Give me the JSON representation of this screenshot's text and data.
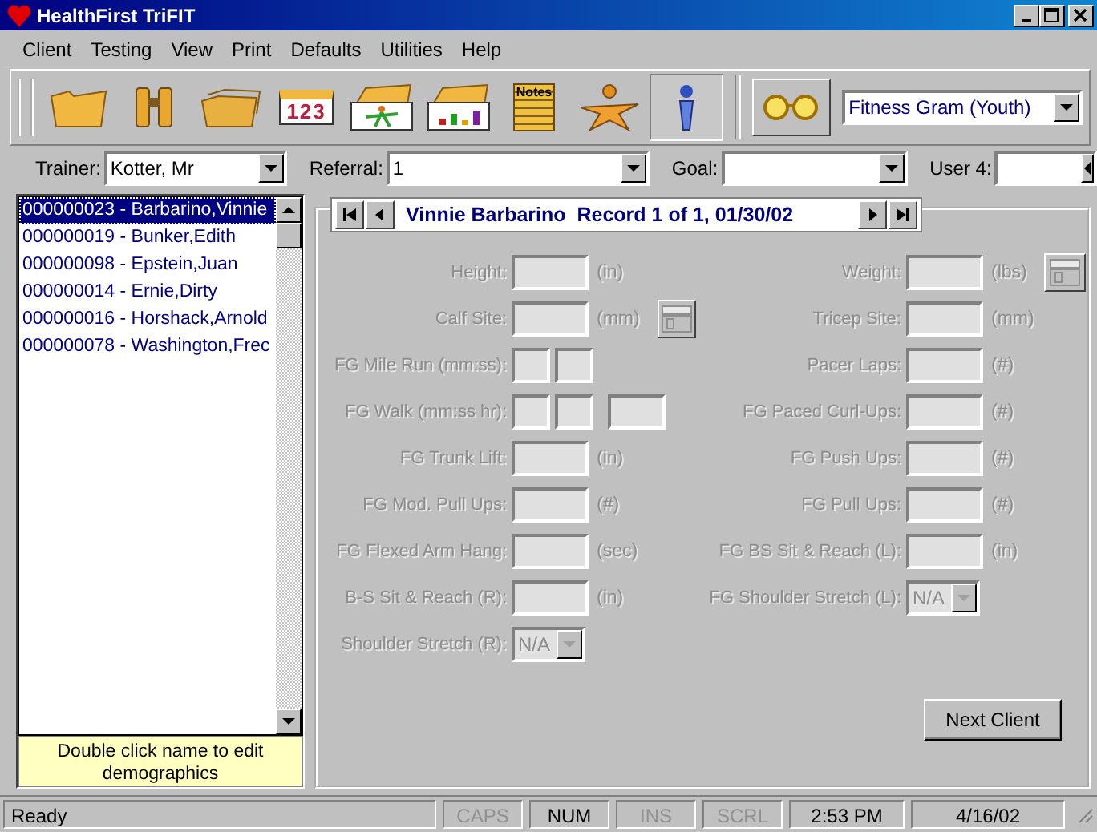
{
  "window": {
    "title": "HealthFirst TriFIT"
  },
  "menu": [
    "Client",
    "Testing",
    "View",
    "Print",
    "Defaults",
    "Utilities",
    "Help"
  ],
  "toolbar": [
    {
      "kind": "folder",
      "selected": false
    },
    {
      "kind": "binoculars",
      "selected": false
    },
    {
      "kind": "folders",
      "selected": false
    },
    {
      "kind": "numbers",
      "label": "123",
      "selected": false
    },
    {
      "kind": "figure-card",
      "selected": false
    },
    {
      "kind": "bar-card",
      "selected": false
    },
    {
      "kind": "notes",
      "label": "Notes",
      "selected": false
    },
    {
      "kind": "star-figure",
      "selected": false
    },
    {
      "kind": "info-figure",
      "selected": true
    },
    {
      "kind": "glasses",
      "selected": false
    }
  ],
  "test_selector": {
    "value": "Fitness Gram (Youth)"
  },
  "filters": [
    {
      "label": "Trainer:",
      "value": "Kotter, Mr"
    },
    {
      "label": "Referral:",
      "value": "1"
    },
    {
      "label": "Goal:"
    },
    {
      "label": "User 4:",
      "kind": "spin"
    }
  ],
  "clients": [
    {
      "text": "000000023 - Barbarino,Vinnie",
      "selected": true
    },
    {
      "text": "000000019 - Bunker,Edith",
      "selected": false
    },
    {
      "text": "000000098 - Epstein,Juan",
      "selected": false
    },
    {
      "text": "000000014 - Ernie,Dirty",
      "selected": false
    },
    {
      "text": "000000016 - Horshack,Arnold",
      "selected": false
    },
    {
      "text": "000000078 - Washington,Frec",
      "selected": false
    }
  ],
  "hint": "Double click name to edit demographics",
  "record": {
    "name": "Vinnie Barbarino",
    "info": "Record 1 of 1, 01/30/02"
  },
  "form": {
    "disabled": true,
    "left": [
      {
        "label": "Height:",
        "kind": "field",
        "unit": "(in)",
        "calculator": false
      },
      {
        "label": "Calf Site:",
        "kind": "field",
        "unit": "(mm)",
        "calculator": true
      },
      {
        "label": "FG Mile Run (mm:ss):",
        "kind": "split2",
        "calculator": false
      },
      {
        "label": "FG Walk (mm:ss hr):",
        "kind": "split3",
        "calculator": false
      },
      {
        "label": "FG Trunk Lift:",
        "kind": "field",
        "unit": "(in)",
        "calculator": false
      },
      {
        "label": "FG Mod. Pull Ups:",
        "kind": "field",
        "unit": "(#)",
        "calculator": false
      },
      {
        "label": "FG Flexed Arm Hang:",
        "kind": "field",
        "unit": "(sec)",
        "calculator": false
      },
      {
        "label": "B-S Sit & Reach (R):",
        "kind": "field",
        "unit": "(in)",
        "calculator": false
      },
      {
        "label": "Shoulder Stretch (R):",
        "kind": "dropdown",
        "value": "N/A",
        "calculator": false
      }
    ],
    "right": [
      {
        "label": "Weight:",
        "kind": "field",
        "unit": "(lbs)",
        "calculator": true
      },
      {
        "label": "Tricep Site:",
        "kind": "field",
        "unit": "(mm)",
        "calculator": false
      },
      {
        "label": "Pacer Laps:",
        "kind": "field",
        "unit": "(#)",
        "calculator": false
      },
      {
        "label": "FG Paced Curl-Ups:",
        "kind": "field",
        "unit": "(#)",
        "calculator": false
      },
      {
        "label": "FG Push Ups:",
        "kind": "field",
        "unit": "(#)",
        "calculator": false
      },
      {
        "label": "FG Pull Ups:",
        "kind": "field",
        "unit": "(#)",
        "calculator": false
      },
      {
        "label": "FG BS Sit & Reach (L):",
        "kind": "field",
        "unit": "(in)",
        "calculator": false
      },
      {
        "label": "FG Shoulder Stretch (L):",
        "kind": "dropdown",
        "value": "N/A",
        "calculator": false
      }
    ]
  },
  "next_button": "Next Client",
  "status_bar": [
    {
      "text": "Ready",
      "kind": "message",
      "on": true
    },
    {
      "text": "CAPS",
      "kind": "key",
      "on": false
    },
    {
      "text": "NUM",
      "kind": "key",
      "on": true
    },
    {
      "text": "INS",
      "kind": "key",
      "on": false
    },
    {
      "text": "SCRL",
      "kind": "key",
      "on": false
    },
    {
      "text": "2:53 PM",
      "kind": "time",
      "on": true
    },
    {
      "text": "4/16/02",
      "kind": "date",
      "on": true
    }
  ]
}
